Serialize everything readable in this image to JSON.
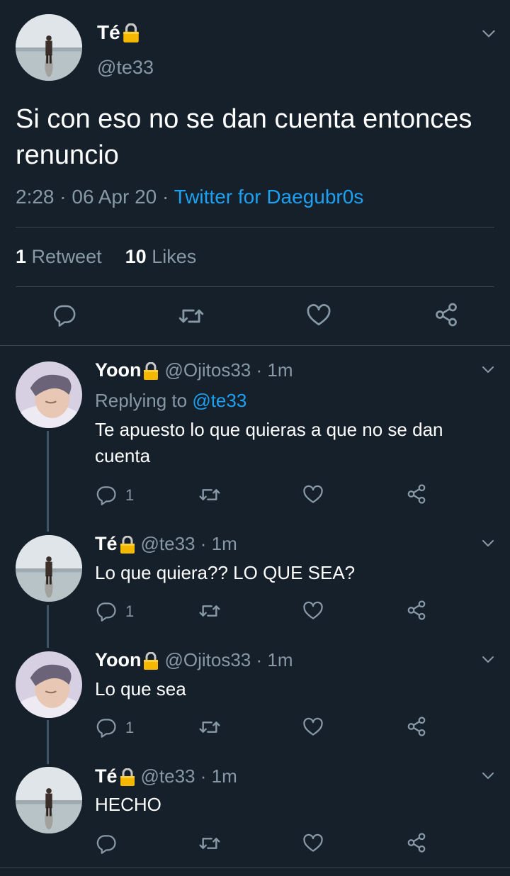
{
  "main_tweet": {
    "name": "Té",
    "handle": "@te33",
    "text": "Si con eso no se dan cuenta entonces renuncio",
    "time": "2:28 · 06 Apr 20 · ",
    "source": "Twitter for Daegubr0s",
    "retweet_count": "1",
    "retweet_label": "Retweet",
    "like_count": "10",
    "like_label": "Likes"
  },
  "replies": [
    {
      "name": "Yoon",
      "handle_time": "@Ojitos33 · 1m",
      "replying_prefix": "Replying to ",
      "replying_handle": "@te33",
      "text": "Te apuesto lo que quieras a que no se dan cuenta",
      "reply_count": "1"
    },
    {
      "name": "Té",
      "handle_time": "@te33 · 1m",
      "text": "Lo que quiera?? LO QUE SEA?",
      "reply_count": "1"
    },
    {
      "name": "Yoon",
      "handle_time": "@Ojitos33 · 1m",
      "text": "Lo que sea",
      "reply_count": "1"
    },
    {
      "name": "Té",
      "handle_time": "@te33 · 1m",
      "text": "HECHO",
      "reply_count": ""
    }
  ],
  "icons": {
    "lock": "lock-icon",
    "reply": "reply-icon",
    "retweet": "retweet-icon",
    "like": "heart-icon",
    "share": "share-icon",
    "more": "chevron-down-icon"
  },
  "colors": {
    "background": "#15202b",
    "accent": "#1da1f2",
    "secondary_text": "#8899a6",
    "divider": "#38444d",
    "lock": "#f5b800"
  }
}
